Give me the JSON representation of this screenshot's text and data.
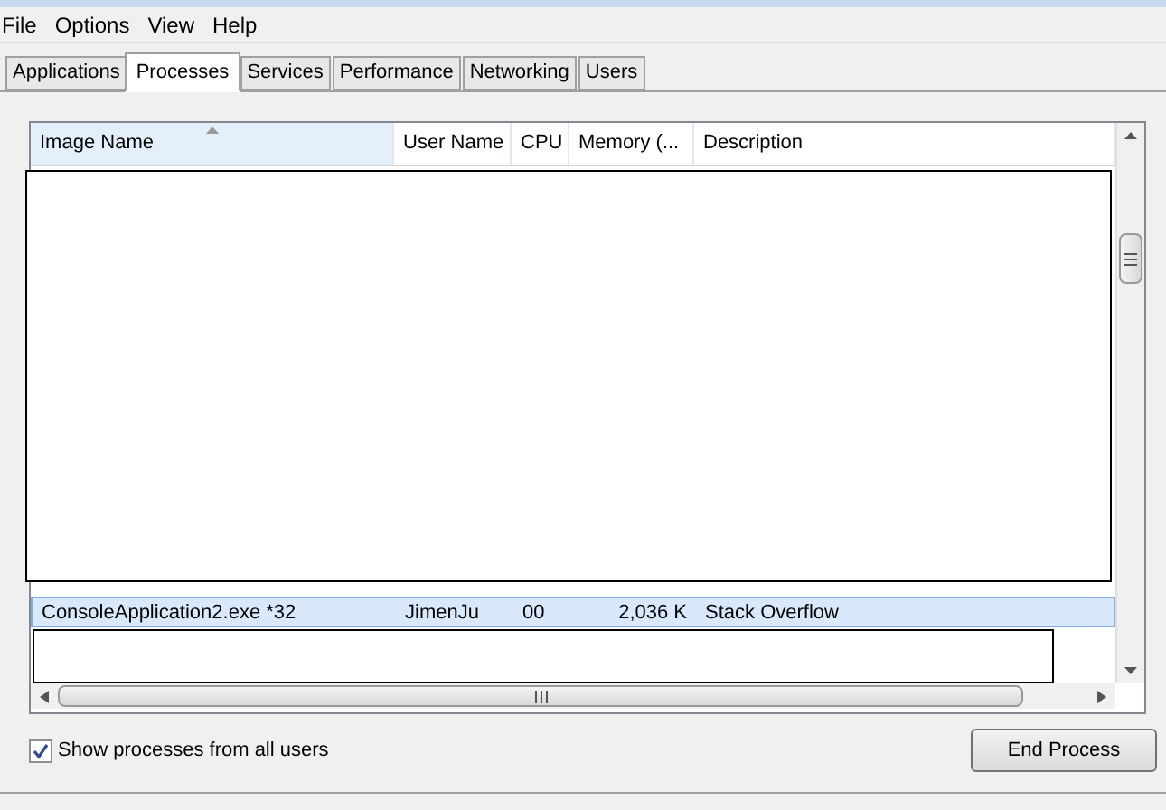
{
  "menu": [
    "File",
    "Options",
    "View",
    "Help"
  ],
  "tabs": [
    {
      "label": "Applications",
      "selected": false
    },
    {
      "label": "Processes",
      "selected": true
    },
    {
      "label": "Services",
      "selected": false
    },
    {
      "label": "Performance",
      "selected": false
    },
    {
      "label": "Networking",
      "selected": false
    },
    {
      "label": "Users",
      "selected": false
    }
  ],
  "table": {
    "columns": [
      {
        "label": "Image Name",
        "sorted": true
      },
      {
        "label": "User Name",
        "sorted": false
      },
      {
        "label": "CPU",
        "sorted": false
      },
      {
        "label": "Memory (...",
        "sorted": false
      },
      {
        "label": "Description",
        "sorted": false
      }
    ],
    "rows": [
      {
        "cells": [
          "ConsoleApplication2.exe *32",
          "JimenJu",
          "00",
          "2,036 K",
          "Stack Overflow"
        ],
        "selected": true
      }
    ]
  },
  "show_all_users": {
    "label": "Show processes from all users",
    "checked": true
  },
  "end_button": "End Process"
}
